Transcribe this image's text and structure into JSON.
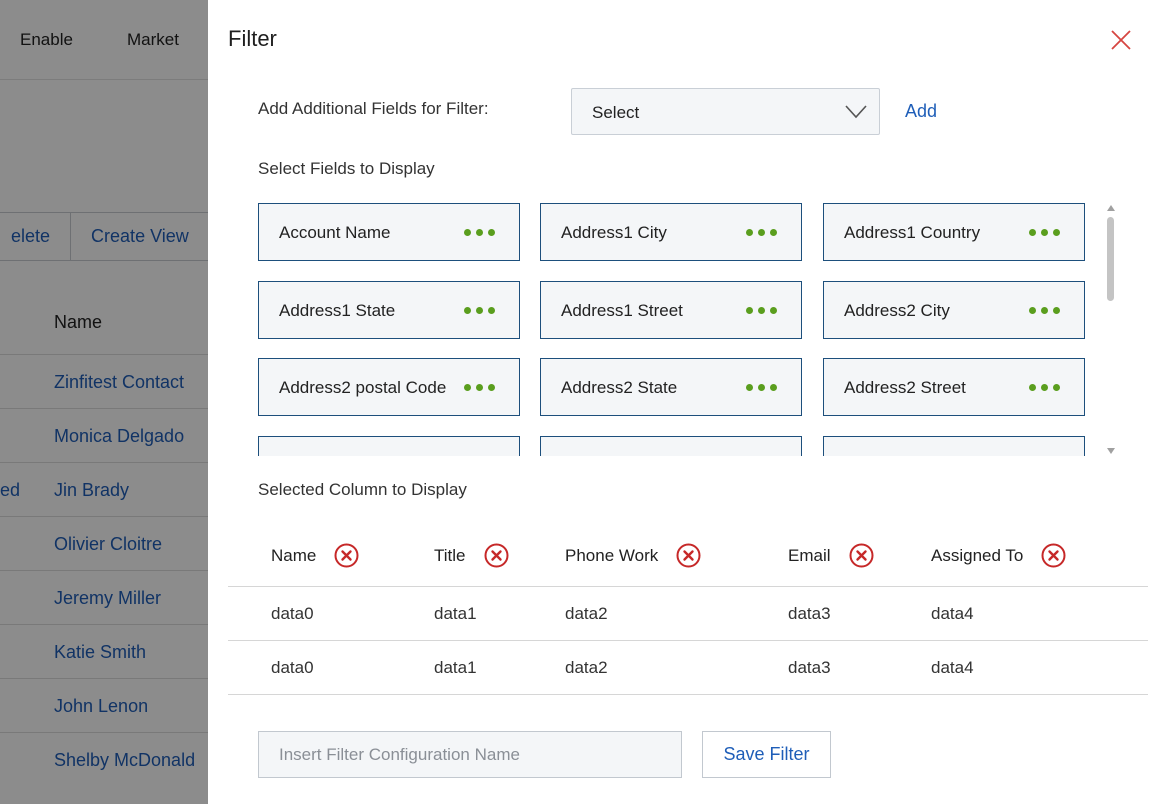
{
  "background": {
    "nav": [
      "Enable",
      "Market"
    ],
    "buttons": [
      "elete",
      "Create View"
    ],
    "column_header": "Name",
    "rows": [
      {
        "status": "",
        "name": "Zinfitest Contact"
      },
      {
        "status": "",
        "name": "Monica Delgado"
      },
      {
        "status": "ed",
        "name": "Jin Brady"
      },
      {
        "status": "",
        "name": "Olivier Cloitre"
      },
      {
        "status": "",
        "name": "Jeremy Miller"
      },
      {
        "status": "",
        "name": "Katie Smith"
      },
      {
        "status": "",
        "name": "John Lenon"
      },
      {
        "status": "",
        "name": "Shelby McDonald"
      }
    ]
  },
  "panel": {
    "title": "Filter",
    "add_fields_label": "Add Additional Fields for Filter:",
    "select_value": "Select",
    "add_label": "Add",
    "fields_label": "Select Fields to Display",
    "fields": [
      "Account Name",
      "Address1 City",
      "Address1 Country",
      "Address1 State",
      "Address1 Street",
      "Address2 City",
      "Address2 postal Code",
      "Address2 State",
      "Address2 Street",
      "",
      "",
      ""
    ],
    "selected_label": "Selected Column to Display",
    "columns": [
      "Name",
      "Title",
      "Phone Work",
      "Email",
      "Assigned To"
    ],
    "rows": [
      [
        "data0",
        "data1",
        "data2",
        "data3",
        "data4"
      ],
      [
        "data0",
        "data1",
        "data2",
        "data3",
        "data4"
      ]
    ],
    "config_placeholder": "Insert Filter Configuration Name",
    "save_label": "Save Filter"
  },
  "colors": {
    "accent": "#1f5eb8",
    "dots": "#5a9e1e",
    "remove": "#c62828",
    "card_border": "#1d4f7c"
  }
}
